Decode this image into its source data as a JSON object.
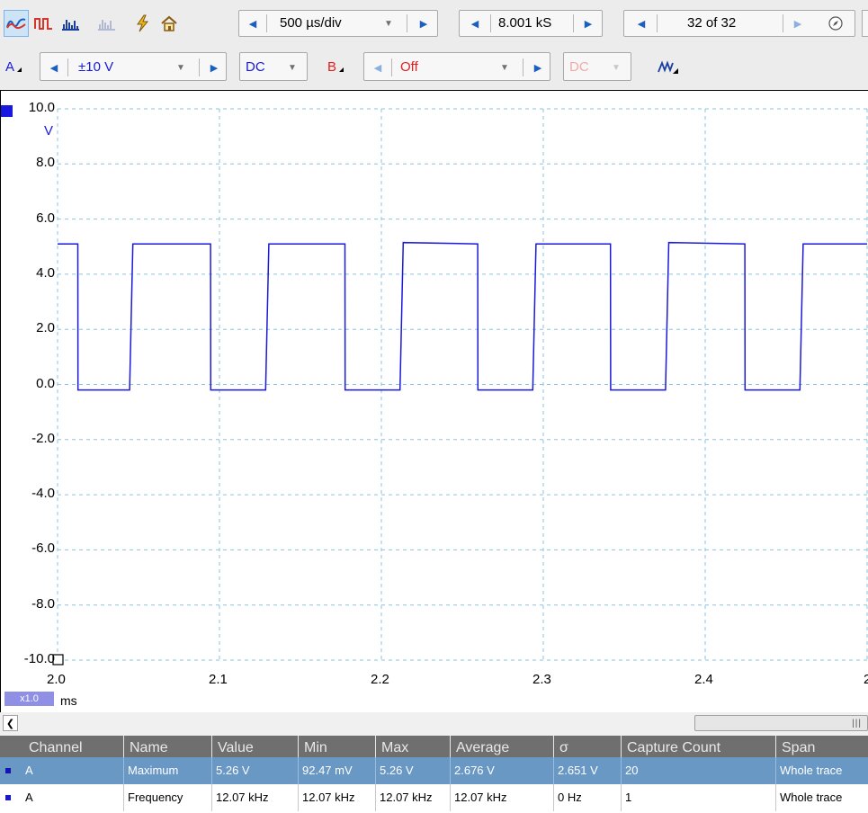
{
  "toolbar": {
    "timebase": "500 µs/div",
    "samples": "8.001 kS",
    "buffer": "32 of 32",
    "icons": [
      "scope-mode-icon",
      "persistence-mode-icon",
      "spectrum-mode-icon",
      "spectrum-disabled-icon",
      "auto-setup-icon",
      "home-icon",
      "compass-icon"
    ]
  },
  "channel_a": {
    "label": "A",
    "range": "±10 V",
    "coupling": "DC",
    "color": "#1a1adc"
  },
  "channel_b": {
    "label": "B",
    "range": "Off",
    "coupling": "DC",
    "color": "#e02020"
  },
  "scope": {
    "unit_y": "V",
    "unit_x": "ms",
    "zoom": "x1.0",
    "y_ticks": [
      "10.0",
      "8.0",
      "6.0",
      "4.0",
      "2.0",
      "0.0",
      "-2.0",
      "-4.0",
      "-6.0",
      "-8.0",
      "-10.0"
    ],
    "x_ticks": [
      "2.0",
      "2.1",
      "2.2",
      "2.3",
      "2.4",
      "2"
    ]
  },
  "chart_data": {
    "type": "line",
    "xlabel": "ms",
    "ylabel": "V",
    "xlim": [
      2.0,
      2.5
    ],
    "ylim": [
      -10.0,
      10.0
    ],
    "grid": true,
    "series": [
      {
        "name": "A",
        "color": "#1a1adc",
        "x": [
          2.0,
          2.0125,
          2.0126,
          2.0445,
          2.0465,
          2.0945,
          2.0946,
          2.1285,
          2.1305,
          2.1775,
          2.1776,
          2.2115,
          2.2135,
          2.2595,
          2.2596,
          2.2935,
          2.2955,
          2.3415,
          2.3416,
          2.3755,
          2.3775,
          2.4245,
          2.4246,
          2.4585,
          2.4605,
          2.5
        ],
        "y": [
          5.1,
          5.1,
          -0.2,
          -0.2,
          5.1,
          5.1,
          -0.2,
          -0.2,
          5.1,
          5.1,
          -0.2,
          -0.2,
          5.15,
          5.1,
          -0.2,
          -0.2,
          5.1,
          5.1,
          -0.2,
          -0.2,
          5.15,
          5.1,
          -0.2,
          -0.2,
          5.1,
          5.1
        ]
      }
    ]
  },
  "measurements": {
    "headers": [
      "Channel",
      "Name",
      "Value",
      "Min",
      "Max",
      "Average",
      "σ",
      "Capture Count",
      "Span"
    ],
    "rows": [
      [
        "A",
        "Maximum",
        "5.26 V",
        "92.47 mV",
        "5.26 V",
        "2.676 V",
        "2.651 V",
        "20",
        "Whole trace"
      ],
      [
        "A",
        "Frequency",
        "12.07 kHz",
        "12.07 kHz",
        "12.07 kHz",
        "12.07 kHz",
        "0 Hz",
        "1",
        "Whole trace"
      ]
    ]
  }
}
